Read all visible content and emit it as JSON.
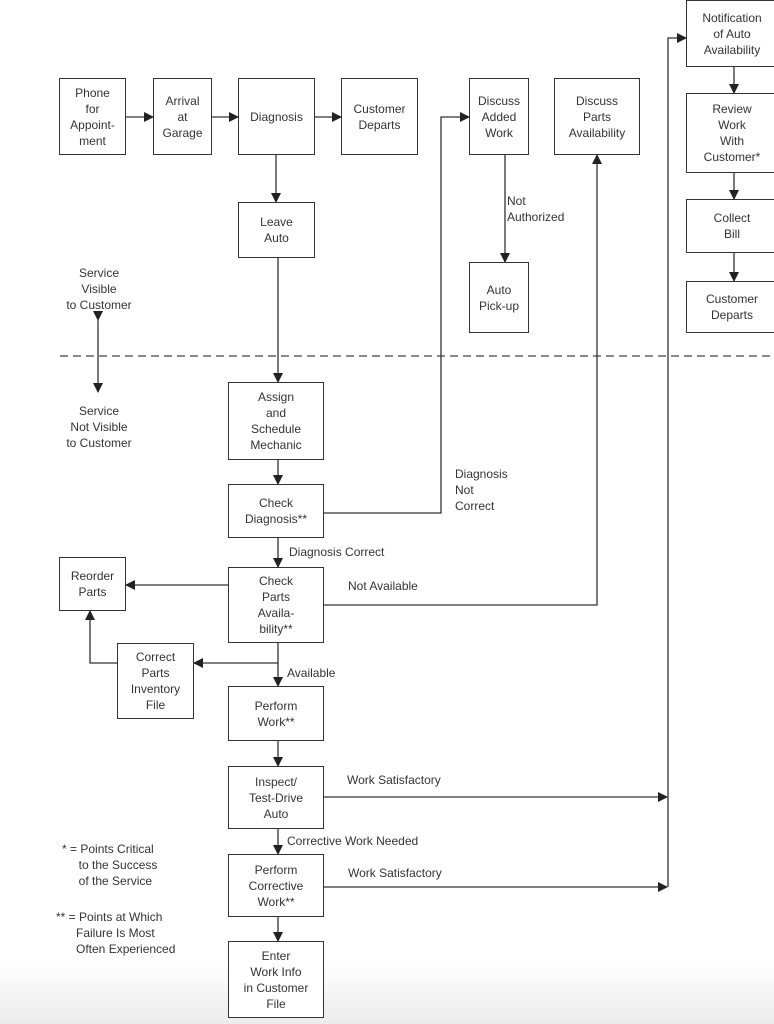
{
  "boxes": {
    "phone": [
      "Phone",
      "for",
      "Appoint-",
      "ment"
    ],
    "arrival": [
      "Arrival",
      "at",
      "Garage"
    ],
    "diagnosis": [
      "Diagnosis"
    ],
    "customer_departs_1": [
      "Customer",
      "Departs"
    ],
    "discuss_added_work": [
      "Discuss",
      "Added",
      "Work"
    ],
    "discuss_parts": [
      "Discuss",
      "Parts",
      "Availability"
    ],
    "notification": [
      "Notification",
      "of Auto",
      "Availability"
    ],
    "review_work": [
      "Review",
      "Work",
      "With",
      "Customer*"
    ],
    "collect_bill": [
      "Collect",
      "Bill"
    ],
    "customer_departs_2": [
      "Customer",
      "Departs"
    ],
    "leave_auto": [
      "Leave",
      "Auto"
    ],
    "auto_pickup": [
      "Auto",
      "Pick-up"
    ],
    "assign_mechanic": [
      "Assign",
      "and",
      "Schedule",
      "Mechanic"
    ],
    "check_diagnosis": [
      "Check",
      "Diagnosis**"
    ],
    "check_parts": [
      "Check",
      "Parts",
      "Availa-",
      "bility**"
    ],
    "reorder_parts": [
      "Reorder",
      "Parts"
    ],
    "correct_inventory": [
      "Correct",
      "Parts",
      "Inventory",
      "File"
    ],
    "perform_work": [
      "Perform",
      "Work**"
    ],
    "inspect": [
      "Inspect/",
      "Test-Drive",
      "Auto"
    ],
    "corrective_work": [
      "Perform",
      "Corrective",
      "Work**"
    ],
    "enter_info": [
      "Enter",
      "Work Info",
      "in Customer",
      "File"
    ]
  },
  "labels": {
    "not_authorized": [
      "Not",
      "Authorized"
    ],
    "diagnosis_not_correct": [
      "Diagnosis",
      "Not",
      "Correct"
    ],
    "diagnosis_correct": [
      "Diagnosis Correct"
    ],
    "not_available": [
      "Not Available"
    ],
    "available": [
      "Available"
    ],
    "work_satisfactory_1": [
      "Work Satisfactory"
    ],
    "corrective_work_needed": [
      "Corrective Work Needed"
    ],
    "work_satisfactory_2": [
      "Work Satisfactory"
    ],
    "service_visible": [
      "Service",
      "Visible",
      "to Customer"
    ],
    "service_not_visible": [
      "Service",
      "Not Visible",
      "to Customer"
    ],
    "legend_critical": [
      "* = Points Critical",
      "     to the Success",
      "     of the Service"
    ],
    "legend_failure": [
      "** = Points at Which",
      "      Failure Is Most",
      "      Often Experienced"
    ]
  },
  "line_of_visibility": "dashed"
}
